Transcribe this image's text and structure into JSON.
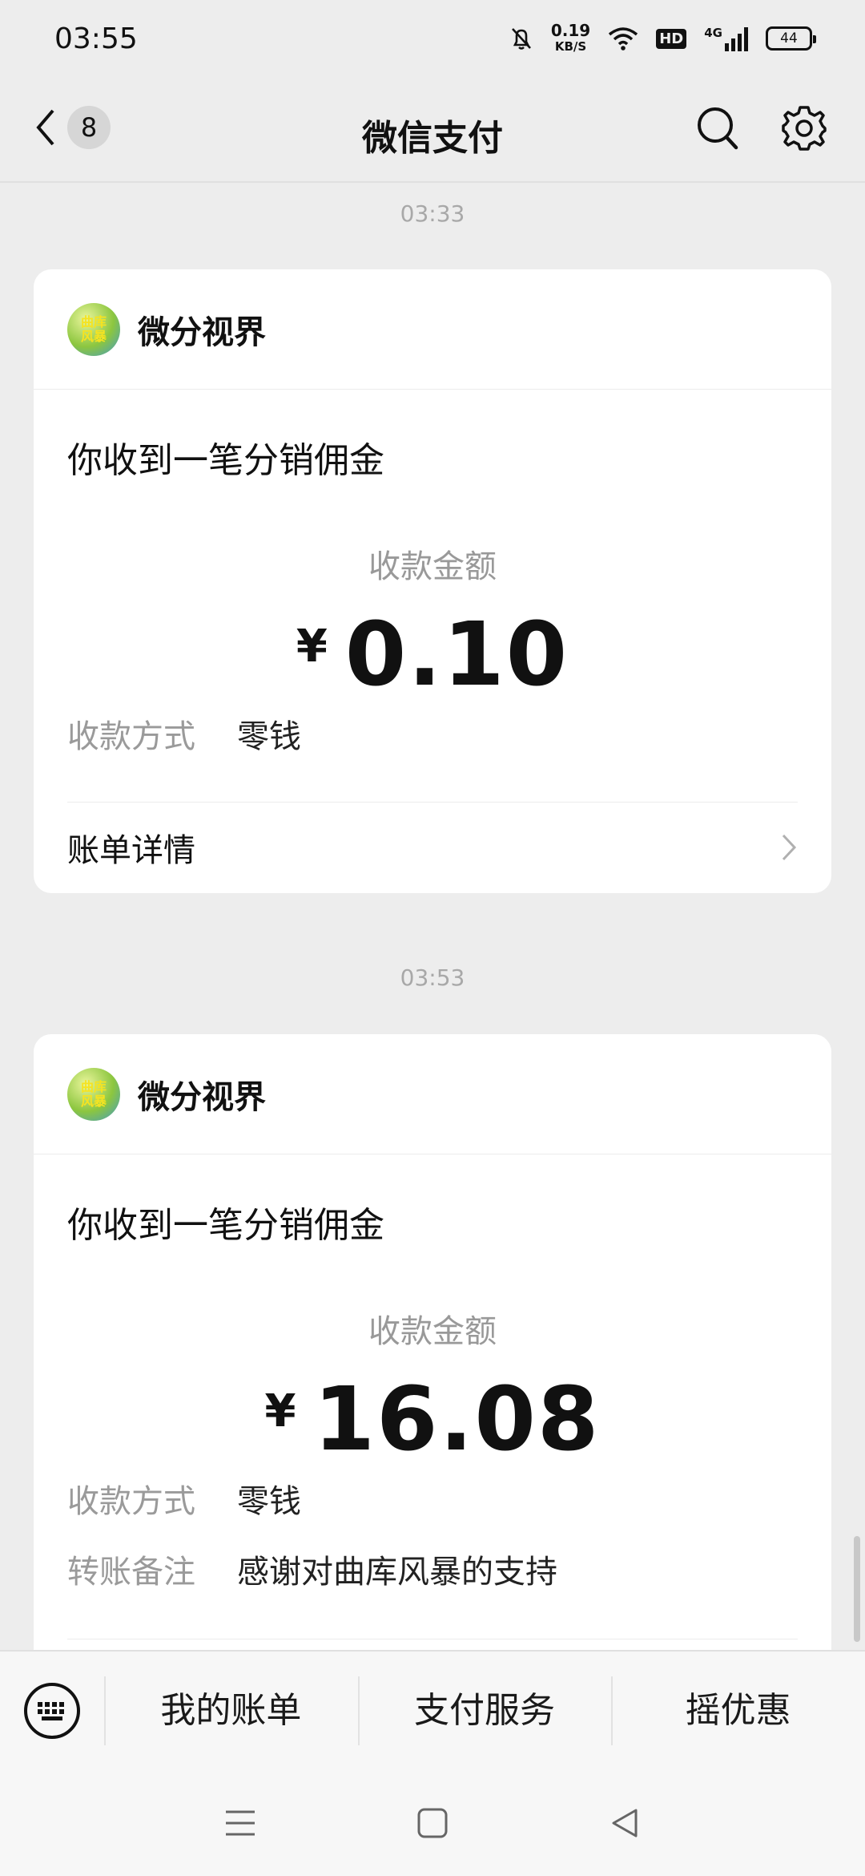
{
  "status": {
    "time": "03:55",
    "net_speed": "0.19",
    "net_unit": "KB/S",
    "hd": "HD",
    "signal": "4G",
    "battery": "44"
  },
  "nav": {
    "back_count": "8",
    "title": "微信支付"
  },
  "messages": [
    {
      "time": "03:33",
      "merchant": "微分视界",
      "avatar_text": "曲库风暴",
      "title": "你收到一笔分销佣金",
      "amount_label": "收款金额",
      "currency": "¥",
      "amount": "0.10",
      "method_label": "收款方式",
      "method": "零钱",
      "detail_label": "账单详情"
    },
    {
      "time": "03:53",
      "merchant": "微分视界",
      "avatar_text": "曲库风暴",
      "title": "你收到一笔分销佣金",
      "amount_label": "收款金额",
      "currency": "¥",
      "amount": "16.08",
      "method_label": "收款方式",
      "method": "零钱",
      "note_label": "转账备注",
      "note": "感谢对曲库风暴的支持"
    }
  ],
  "menu": {
    "items": [
      "我的账单",
      "支付服务",
      "摇优惠"
    ]
  },
  "icons": {
    "back": "chevron-left-icon",
    "search": "search-icon",
    "settings": "gear-icon",
    "keyboard": "keyboard-icon",
    "detail": "chevron-right-icon",
    "sys_menu": "menu-icon",
    "sys_home": "home-icon",
    "sys_back": "back-triangle-icon"
  }
}
